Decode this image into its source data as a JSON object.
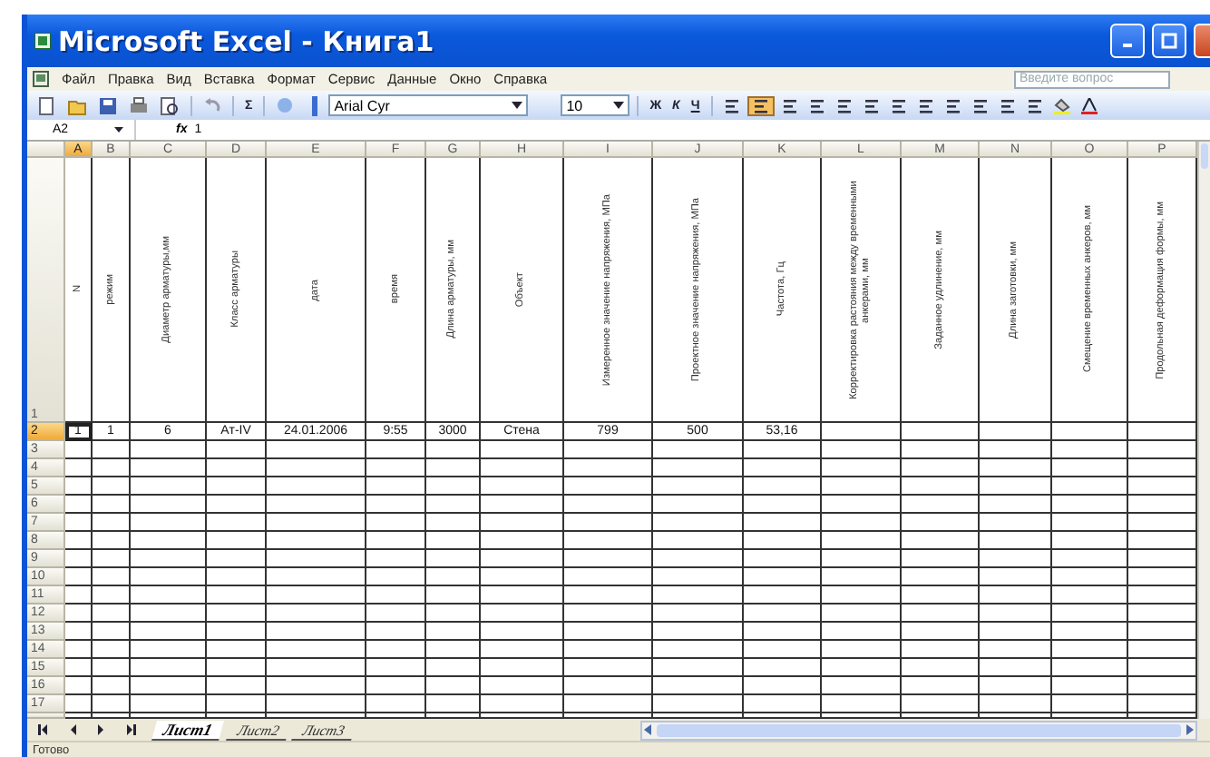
{
  "window": {
    "title": "Microsoft Excel - Книга1"
  },
  "menu": {
    "items": [
      "Файл",
      "Правка",
      "Вид",
      "Вставка",
      "Формат",
      "Сервис",
      "Данные",
      "Окно",
      "Справка"
    ],
    "help_field": {
      "placeholder": "Введите вопрос"
    }
  },
  "toolbar": {
    "sum": "Σ",
    "font": "Arial Cyr",
    "size": "10",
    "format_buttons": [
      "Ж",
      "К",
      "Ч"
    ]
  },
  "formula_bar": {
    "name_box": "A2",
    "fx": "fx",
    "value": "1"
  },
  "columns": [
    {
      "letter": "A",
      "selected": true
    },
    {
      "letter": "B",
      "selected": false
    },
    {
      "letter": "C",
      "selected": false
    },
    {
      "letter": "D",
      "selected": false
    },
    {
      "letter": "E",
      "selected": false
    },
    {
      "letter": "F",
      "selected": false
    },
    {
      "letter": "G",
      "selected": false
    },
    {
      "letter": "H",
      "selected": false
    },
    {
      "letter": "I",
      "selected": false
    },
    {
      "letter": "J",
      "selected": false
    },
    {
      "letter": "K",
      "selected": false
    },
    {
      "letter": "L",
      "selected": false
    },
    {
      "letter": "M",
      "selected": false
    },
    {
      "letter": "N",
      "selected": false
    },
    {
      "letter": "O",
      "selected": false
    },
    {
      "letter": "P",
      "selected": false
    }
  ],
  "rows": [
    {
      "number": "1",
      "selected": false,
      "cells": [
        "N",
        "режим",
        "Диаметр арматуры,мм",
        "Класс арматуры",
        "дата",
        "время",
        "Длина арматуры, мм",
        "Объект",
        "Измеренное значение напряжения, МПа",
        "Проектное значение напряжения, МПа",
        "Частота, Гц",
        "Корректировка растояния между временными анкерами, мм",
        "Заданное удлинение, мм",
        "Длина заготовки, мм",
        "Смещение временных анкеров, мм",
        "Продольная деформация формы, мм"
      ]
    },
    {
      "number": "2",
      "selected": true,
      "cells": [
        "1",
        "1",
        "6",
        "Aт-IV",
        "24.01.2006",
        "9:55",
        "3000",
        "Стена",
        "799",
        "500",
        "53,16"
      ]
    },
    {
      "number": "3",
      "selected": false
    },
    {
      "number": "4",
      "selected": false
    },
    {
      "number": "5",
      "selected": false
    },
    {
      "number": "6",
      "selected": false
    },
    {
      "number": "7",
      "selected": false
    },
    {
      "number": "8",
      "selected": false
    },
    {
      "number": "9",
      "selected": false
    },
    {
      "number": "10",
      "selected": false
    },
    {
      "number": "11",
      "selected": false
    },
    {
      "number": "12",
      "selected": false
    },
    {
      "number": "13",
      "selected": false
    },
    {
      "number": "14",
      "selected": false
    },
    {
      "number": "15",
      "selected": false
    },
    {
      "number": "16",
      "selected": false
    },
    {
      "number": "17",
      "selected": false
    }
  ],
  "sheets": [
    {
      "label": "Лист1",
      "selected": true
    },
    {
      "label": "Лист2",
      "selected": false
    },
    {
      "label": "Лист3",
      "selected": false
    }
  ],
  "status_bar": {
    "text": "Готово"
  }
}
